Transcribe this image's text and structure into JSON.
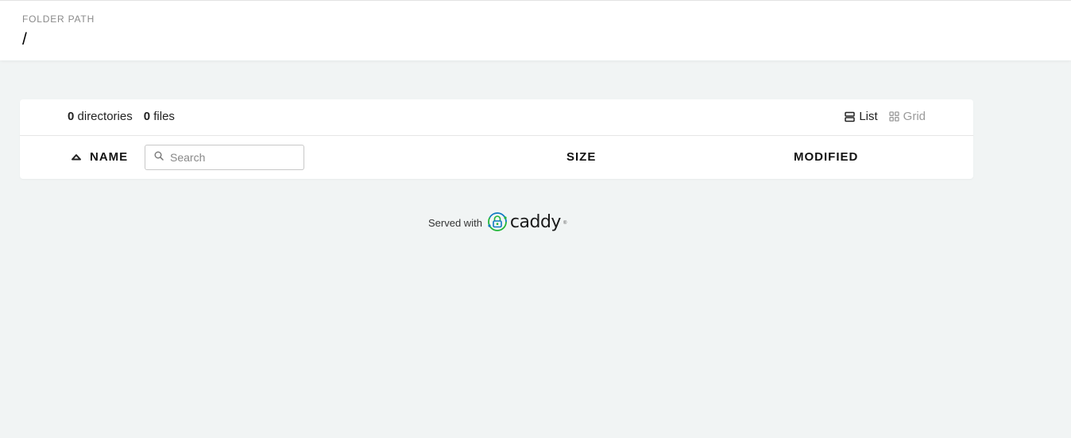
{
  "header": {
    "folder_label": "Folder Path",
    "path": "/"
  },
  "summary": {
    "dir_count": "0",
    "dir_label": "directories",
    "file_count": "0",
    "file_label": "files"
  },
  "view_toggle": {
    "list_label": "List",
    "grid_label": "Grid",
    "active": "List"
  },
  "table": {
    "columns": {
      "name": "Name",
      "size": "Size",
      "modified": "Modified"
    },
    "sort_icon": "sort-ascending-icon"
  },
  "search": {
    "placeholder": "Search",
    "value": ""
  },
  "footer": {
    "served_with": "Served with",
    "brand": "caddy",
    "brand_colors": {
      "green": "#22b638",
      "blue": "#0f7ac2"
    }
  }
}
